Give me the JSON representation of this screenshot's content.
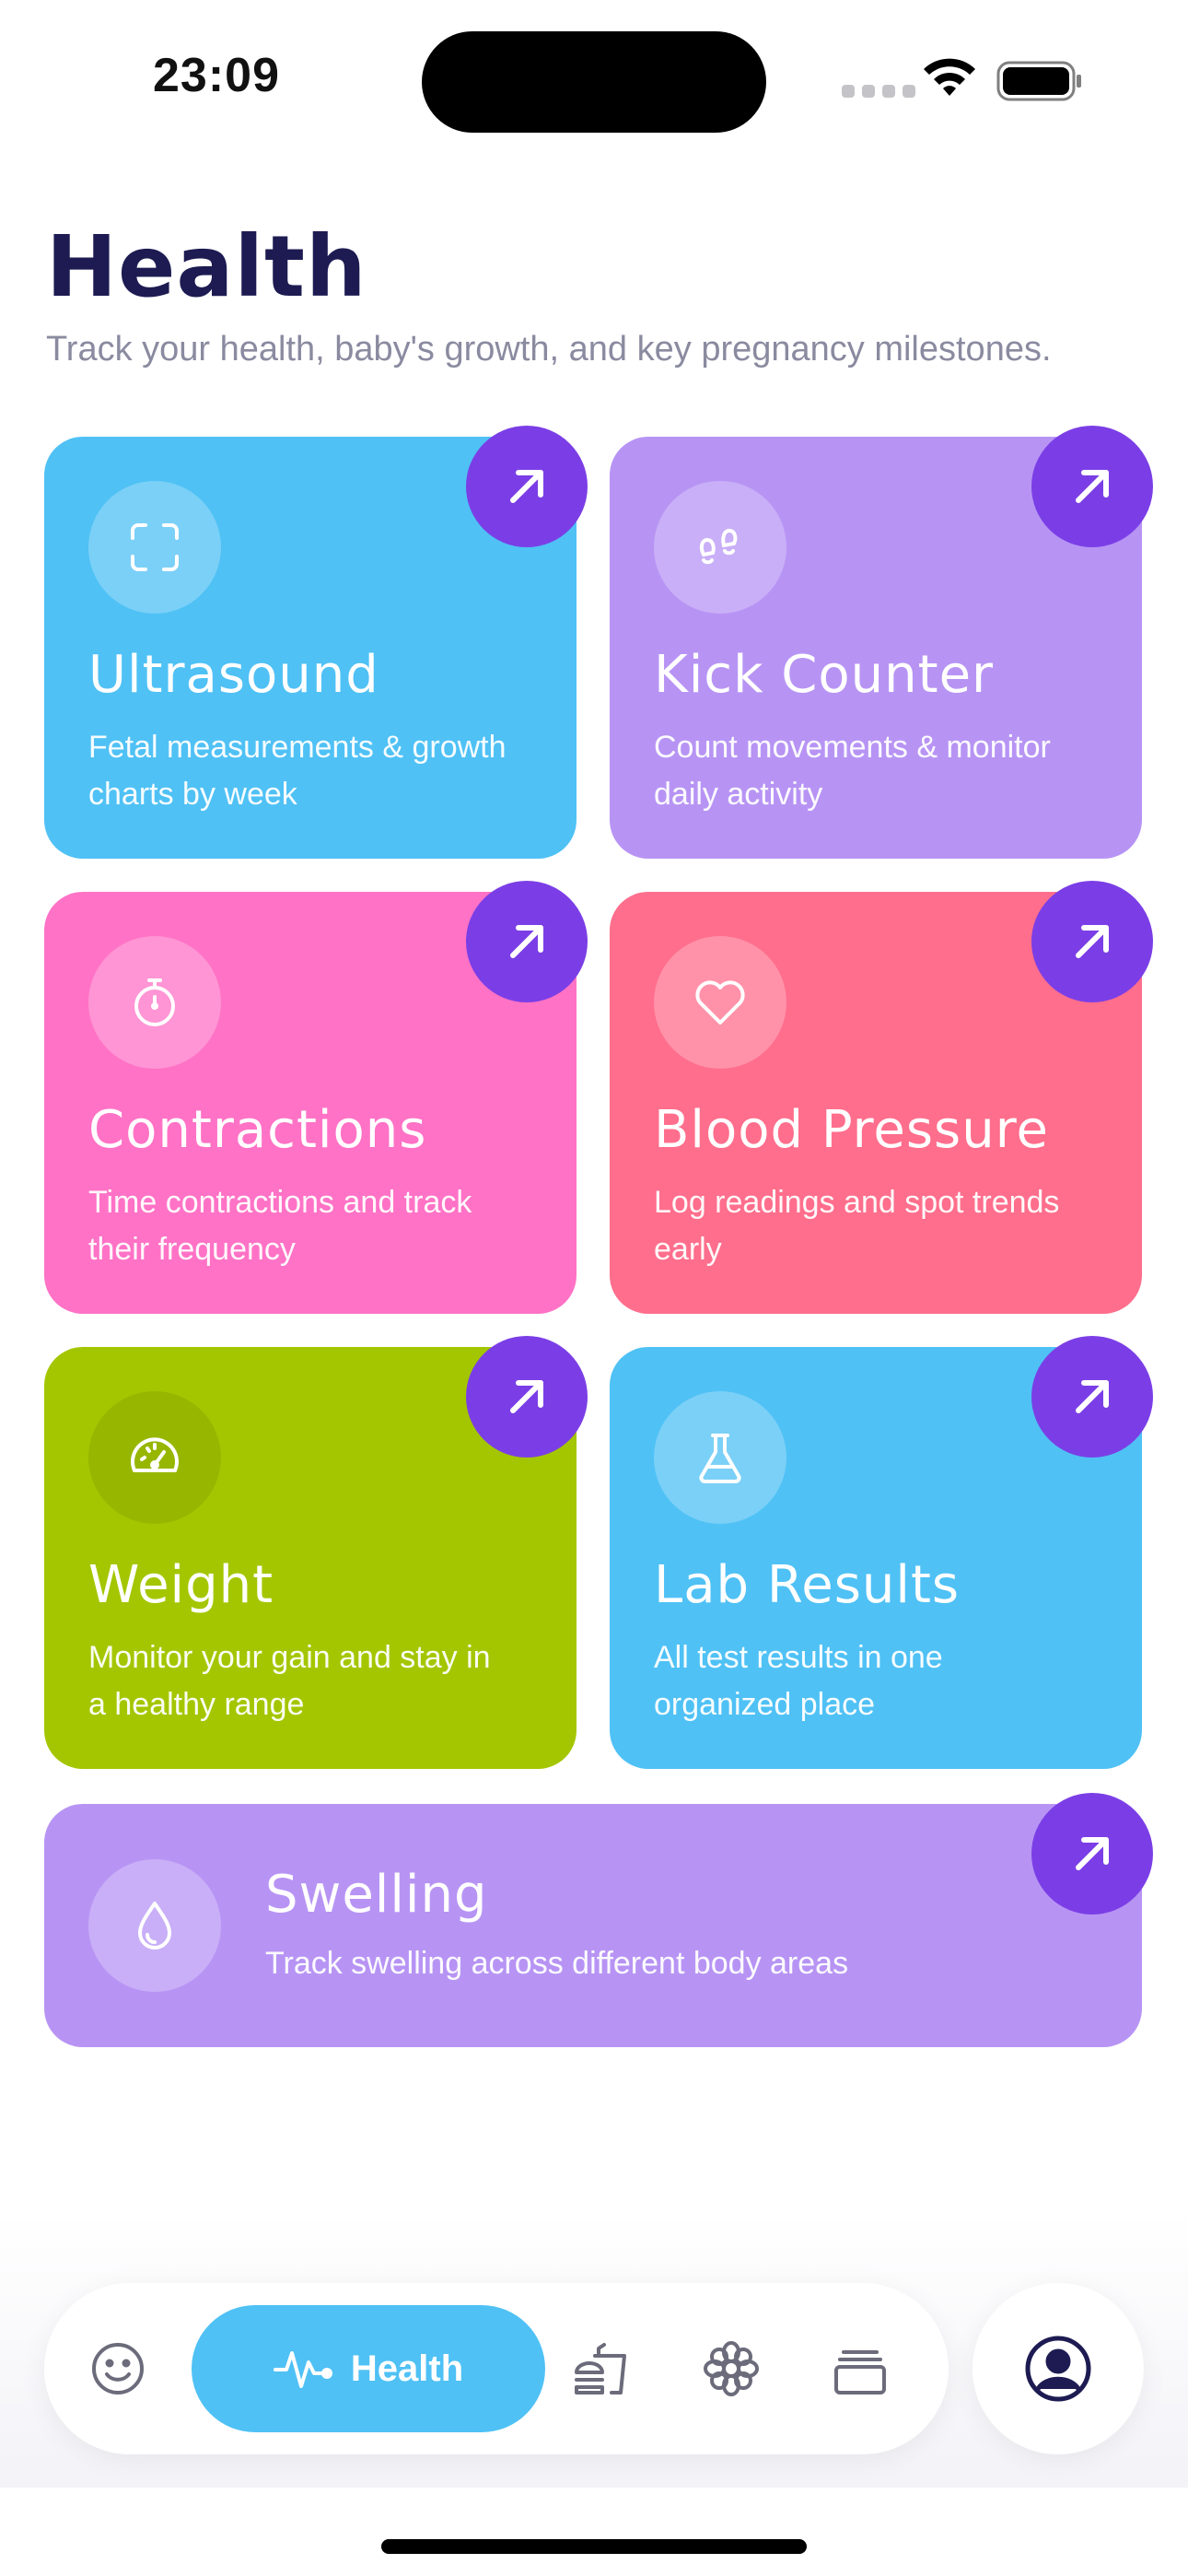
{
  "status_bar": {
    "time": "23:09"
  },
  "header": {
    "title": "Health",
    "subtitle": "Track your health, baby's growth, and key pregnancy milestones."
  },
  "cards": [
    {
      "title": "Ultrasound",
      "description": "Fetal measurements & growth charts by week",
      "icon": "scan-icon",
      "color": "#4fc1f5"
    },
    {
      "title": "Kick Counter",
      "description": "Count movements & monitor daily activity",
      "icon": "footprints-icon",
      "color": "#b794f4"
    },
    {
      "title": "Contractions",
      "description": "Time contractions and track their frequency",
      "icon": "stopwatch-icon",
      "color": "#ff72c6"
    },
    {
      "title": "Blood Pressure",
      "description": "Log readings and spot trends early",
      "icon": "heart-icon",
      "color": "#ff6e8c"
    },
    {
      "title": "Weight",
      "description": "Monitor your gain and stay in a healthy range",
      "icon": "gauge-icon",
      "color": "#a4c600"
    },
    {
      "title": "Lab Results",
      "description": "All test results in one organized place",
      "icon": "flask-icon",
      "color": "#4fc1f5"
    },
    {
      "title": "Swelling",
      "description": "Track swelling across different body areas",
      "icon": "droplet-icon",
      "color": "#b794f4"
    }
  ],
  "nav": {
    "active_label": "Health",
    "items": [
      "smiley-icon",
      "pulse-icon",
      "burger-drink-icon",
      "flower-icon",
      "cards-stack-icon",
      "profile-icon"
    ]
  },
  "colors": {
    "accent_arrow": "#7b3ee6",
    "title_text": "#1d1b52",
    "subtitle_text": "#8a8aa0"
  }
}
